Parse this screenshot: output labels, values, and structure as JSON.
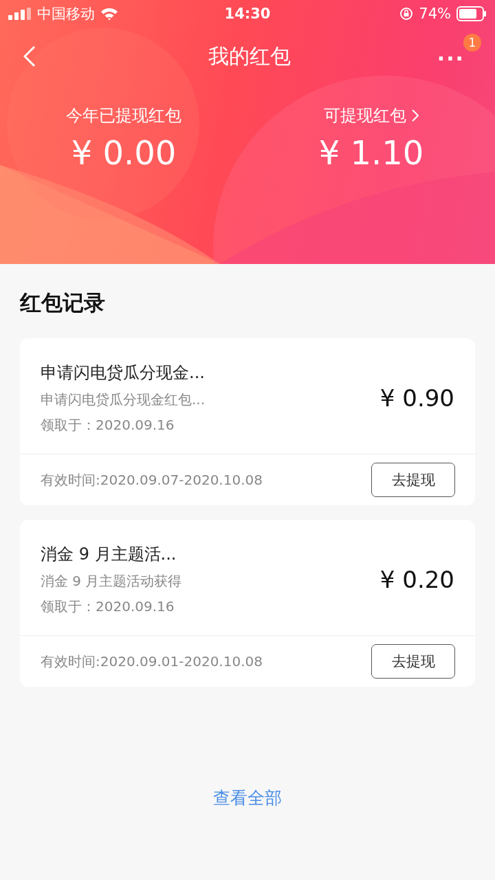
{
  "status_bar": {
    "carrier": "中国移动",
    "time": "14:30",
    "battery": "74%"
  },
  "header": {
    "title": "我的红包",
    "more": "...",
    "badge": "1"
  },
  "summary": [
    {
      "label": "今年已提现红包",
      "amount": "¥ 0.00",
      "link": false
    },
    {
      "label": "可提现红包",
      "amount": "¥ 1.10",
      "link": true
    }
  ],
  "section_title": "红包记录",
  "records": [
    {
      "title": "申请闪电贷瓜分现金...",
      "subtitle": "申请闪电贷瓜分现金红包...",
      "received": "领取于：2020.09.16",
      "amount": "¥ 0.90",
      "validity": "有效时间:2020.09.07-2020.10.08",
      "action": "去提现"
    },
    {
      "title": "消金 9 月主题活...",
      "subtitle": "消金 9 月主题活动获得",
      "received": "领取于：2020.09.16",
      "amount": "¥ 0.20",
      "validity": "有效时间:2020.09.01-2020.10.08",
      "action": "去提现"
    }
  ],
  "view_all": "查看全部"
}
